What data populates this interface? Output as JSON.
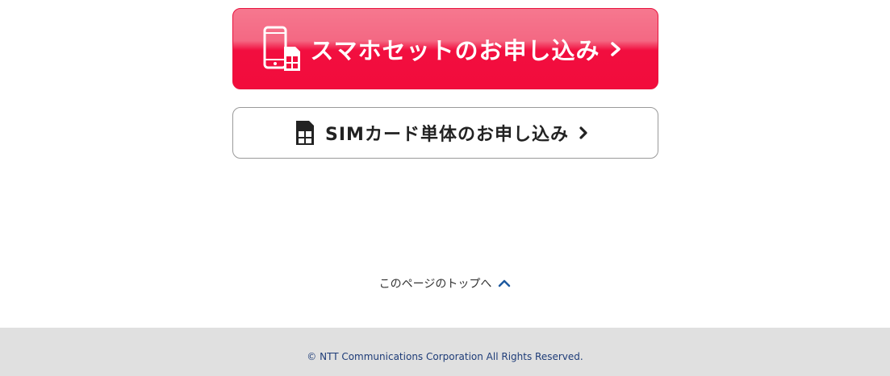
{
  "buttons": {
    "smartphone_set": {
      "label": "スマホセットのお申し込み",
      "icon": "smartphone-sim-icon",
      "color": "#f20c3c"
    },
    "sim_only": {
      "label": "SIMカード単体のお申し込み",
      "icon": "sim-card-icon"
    }
  },
  "page_top": {
    "label": "このページのトップへ",
    "icon": "chevron-up-icon",
    "color": "#1e5aa0"
  },
  "footer": {
    "copyright": "© NTT Communications Corporation All Rights Reserved.",
    "background": "#e0e0e0"
  }
}
